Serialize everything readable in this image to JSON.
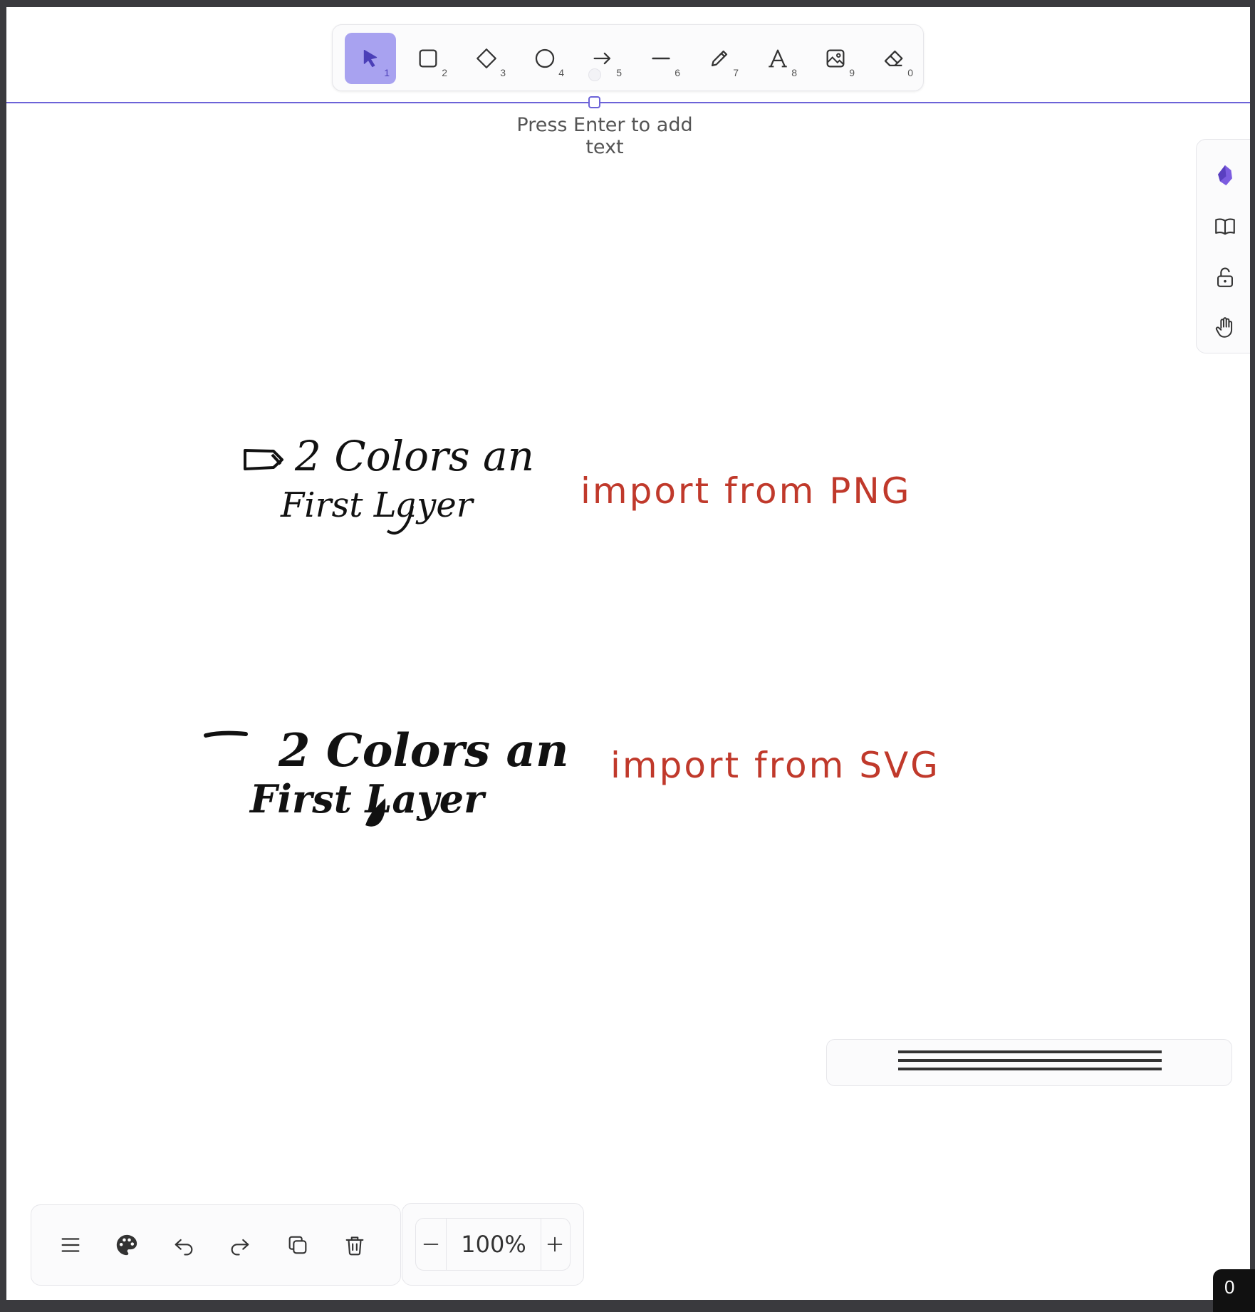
{
  "toolbar": {
    "tools": [
      {
        "name": "selection",
        "key": "1",
        "active": true
      },
      {
        "name": "rectangle",
        "key": "2"
      },
      {
        "name": "diamond",
        "key": "3"
      },
      {
        "name": "ellipse",
        "key": "4"
      },
      {
        "name": "arrow",
        "key": "5"
      },
      {
        "name": "line",
        "key": "6"
      },
      {
        "name": "draw",
        "key": "7"
      },
      {
        "name": "text",
        "key": "8"
      },
      {
        "name": "image",
        "key": "9"
      },
      {
        "name": "eraser",
        "key": "0"
      }
    ]
  },
  "canvas": {
    "text_hint": "Press Enter to add text",
    "notes": [
      {
        "handwritten": "2 Colors an First Layer",
        "label": "import from PNG"
      },
      {
        "handwritten": "2 Colors an First Layer",
        "label": "import from SVG"
      }
    ]
  },
  "sidebar": {
    "icons": [
      "obsidian-icon",
      "library-icon",
      "unlock-icon",
      "hand-icon"
    ]
  },
  "zoom": {
    "level": "100%"
  },
  "corner_badge": {
    "text": "0"
  },
  "colors": {
    "accent": "#a8a2f0",
    "selection": "#6c63d8",
    "ink_red": "#c0392b"
  }
}
